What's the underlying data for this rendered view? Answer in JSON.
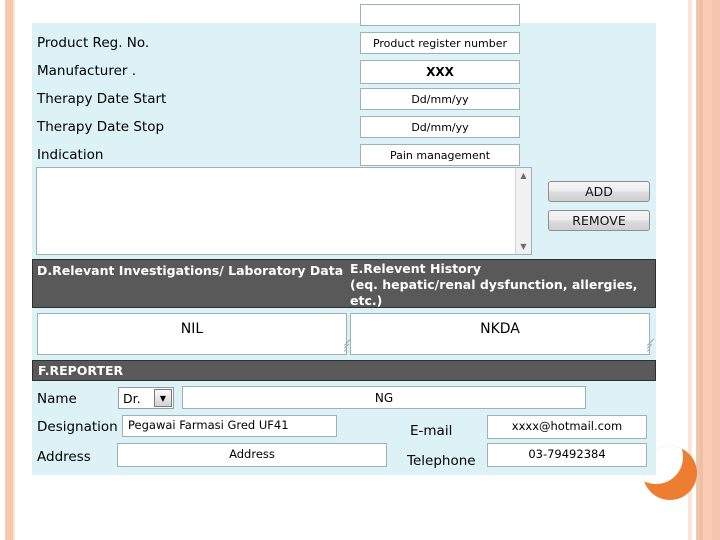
{
  "slide": {
    "accent_orange": "#ED7D31",
    "peach": "#F5C6AC",
    "panel_bg": "#DDF2F7",
    "band_bg": "#595959"
  },
  "form": {
    "product_rows": [
      {
        "label": "Product Reg. No.",
        "value": "Product register number",
        "bold": false
      },
      {
        "label": "Manufacturer .",
        "value": "XXX",
        "bold": true
      },
      {
        "label": "Therapy Date Start",
        "value": "Dd/mm/yy",
        "bold": false
      },
      {
        "label": "Therapy Date Stop",
        "value": "Dd/mm/yy",
        "bold": false
      },
      {
        "label": "Indication",
        "value": "Pain management",
        "bold": false
      }
    ],
    "list_box": {
      "value": ""
    },
    "buttons": {
      "add_label": "ADD",
      "remove_label": "REMOVE"
    },
    "sections": {
      "d": {
        "heading": "D.Relevant Investigations/ Laboratory Data",
        "value": "NIL"
      },
      "e": {
        "heading": "E.Relevent History (eq. hepatic/renal dysfunction, allergies, etc.)",
        "heading_line1": "E.Relevent History",
        "heading_line2": "(eq. hepatic/renal dysfunction, allergies,",
        "heading_line3": "etc.)",
        "value": "NKDA"
      },
      "f": {
        "heading": "F.REPORTER",
        "fields": {
          "name_label": "Name",
          "name_title": "Dr.",
          "name_value": "NG",
          "designation_label": "Designation",
          "designation_value": "Pegawai Farmasi Gred UF41",
          "address_label": "Address",
          "address_value": "Address",
          "email_label": "E-mail",
          "email_value": "xxxx@hotmail.com",
          "telephone_label": "Telephone",
          "telephone_value": "03-79492384"
        }
      }
    }
  },
  "icons": {
    "scroll_up": "▲",
    "scroll_down": "▼",
    "dropdown_arrow": "▼"
  }
}
